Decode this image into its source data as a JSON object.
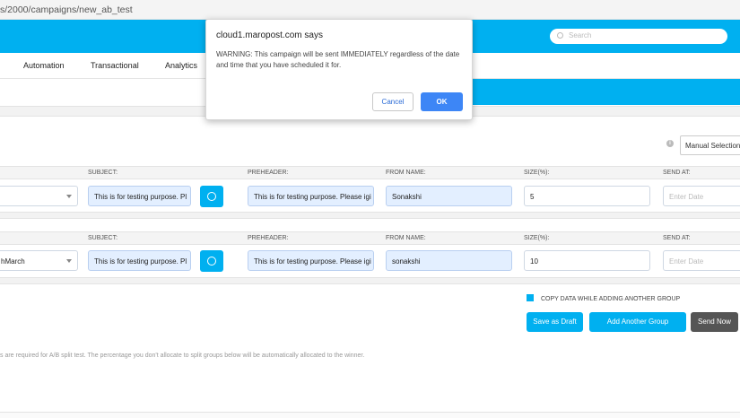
{
  "browser": {
    "url": "s/2000/campaigns/new_ab_test"
  },
  "header": {
    "search_placeholder": "Search"
  },
  "nav": {
    "items": [
      "Automation",
      "Transactional",
      "Analytics"
    ]
  },
  "selection": {
    "mode": "Manual Selection"
  },
  "columns": {
    "subject": "SUBJECT:",
    "preheader": "PREHEADER:",
    "from_name": "FROM NAME:",
    "size": "SIZE(%):",
    "send_at": "SEND AT:"
  },
  "groups": [
    {
      "campaign": "",
      "subject": "This is for testing purpose. Pl",
      "preheader": "This is for testing purpose. Please igi",
      "from_name": "Sonakshi",
      "size": "5",
      "send_at_placeholder": "Enter Date"
    },
    {
      "campaign": "hMarch",
      "subject": "This is for testing purpose. Pl",
      "preheader": "This is for testing purpose. Please igi",
      "from_name": "sonakshi",
      "size": "10",
      "send_at_placeholder": "Enter Date"
    }
  ],
  "actions": {
    "copy_data_label": "COPY DATA WHILE ADDING ANOTHER GROUP",
    "save_draft": "Save as Draft",
    "add_group": "Add Another Group",
    "send_now": "Send Now"
  },
  "note": "s are required for A/B split test. The percentage you don't allocate to split groups below will be automatically allocated to the winner.",
  "dialog": {
    "title": "cloud1.maropost.com says",
    "message": "WARNING: This campaign will be sent IMMEDIATELY regardless of the date and time that you have scheduled it for.",
    "cancel": "Cancel",
    "ok": "OK"
  },
  "colors": {
    "brand": "#00b0f0",
    "dark_button": "#555555",
    "ok_button": "#3d86f6"
  }
}
